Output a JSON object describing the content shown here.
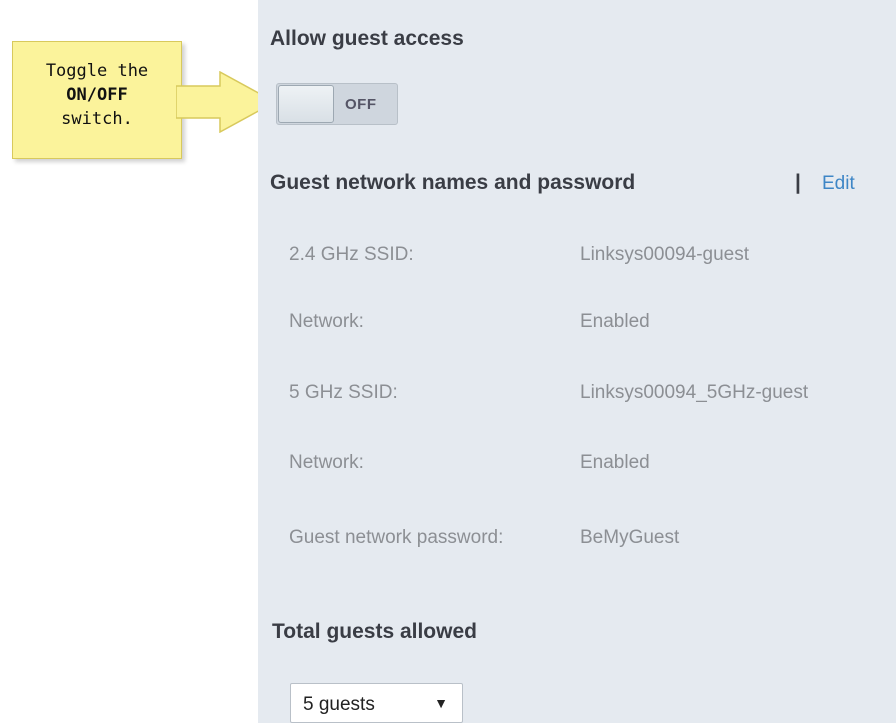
{
  "callout": {
    "line1": "Toggle the",
    "line2": "ON/OFF",
    "line3": "switch."
  },
  "guest_access": {
    "heading": "Allow guest access",
    "toggle_state": "OFF"
  },
  "network_names": {
    "heading": "Guest network names and password",
    "separator": "|",
    "edit_label": "Edit",
    "rows": [
      {
        "label": "2.4 GHz SSID:",
        "value": "Linksys00094-guest"
      },
      {
        "label": "Network:",
        "value": "Enabled"
      },
      {
        "label": "5 GHz SSID:",
        "value": "Linksys00094_5GHz-guest"
      },
      {
        "label": "Network:",
        "value": "Enabled"
      },
      {
        "label": "Guest network password:",
        "value": "BeMyGuest"
      }
    ]
  },
  "total_guests": {
    "heading": "Total guests allowed",
    "selected": "5 guests",
    "caret": "▼"
  },
  "colors": {
    "panel_bg": "#e5eaf0",
    "callout_bg": "#fbf39b",
    "link": "#3e86c6"
  }
}
